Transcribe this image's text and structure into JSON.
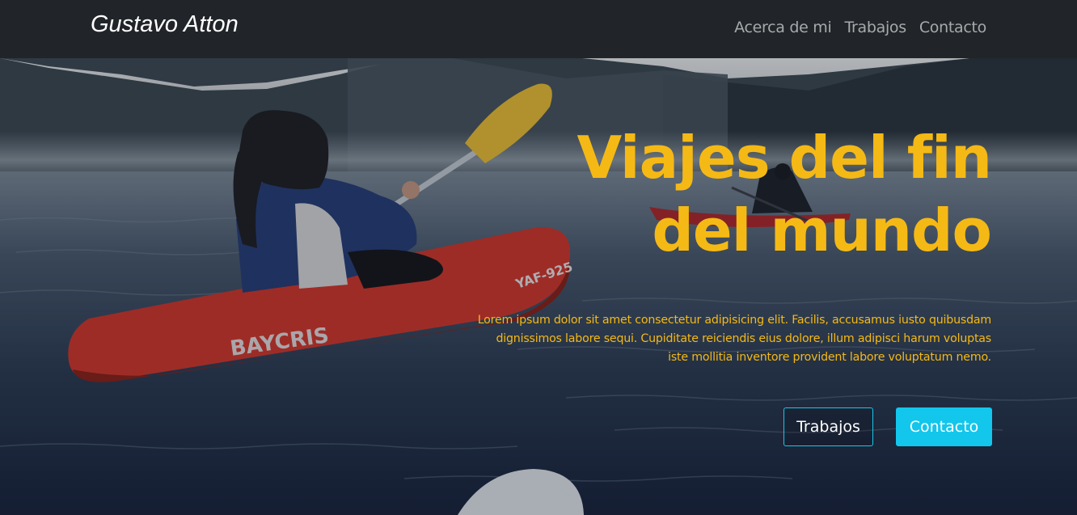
{
  "navbar": {
    "brand": "Gustavo Atton",
    "links": [
      "Acerca de mi",
      "Trabajos",
      "Contacto"
    ]
  },
  "hero": {
    "title_line1": "Viajes del fin",
    "title_line2": "del mundo",
    "text": "Lorem ipsum dolor sit amet consectetur adipisicing elit. Facilis, accusamus iusto quibusdam dignissimos labore sequi. Cupiditate reiciendis eius dolore, illum adipisci harum voluptas iste mollitia inventore provident labore voluptatum nemo.",
    "kayak_text": "BAYCRIS",
    "kayak_code": "YAF-925",
    "buttons": {
      "works": "Trabajos",
      "contact": "Contacto"
    }
  },
  "colors": {
    "navbar_bg": "#212529",
    "accent_yellow": "#f5b915",
    "accent_cyan": "#12c6ec"
  }
}
